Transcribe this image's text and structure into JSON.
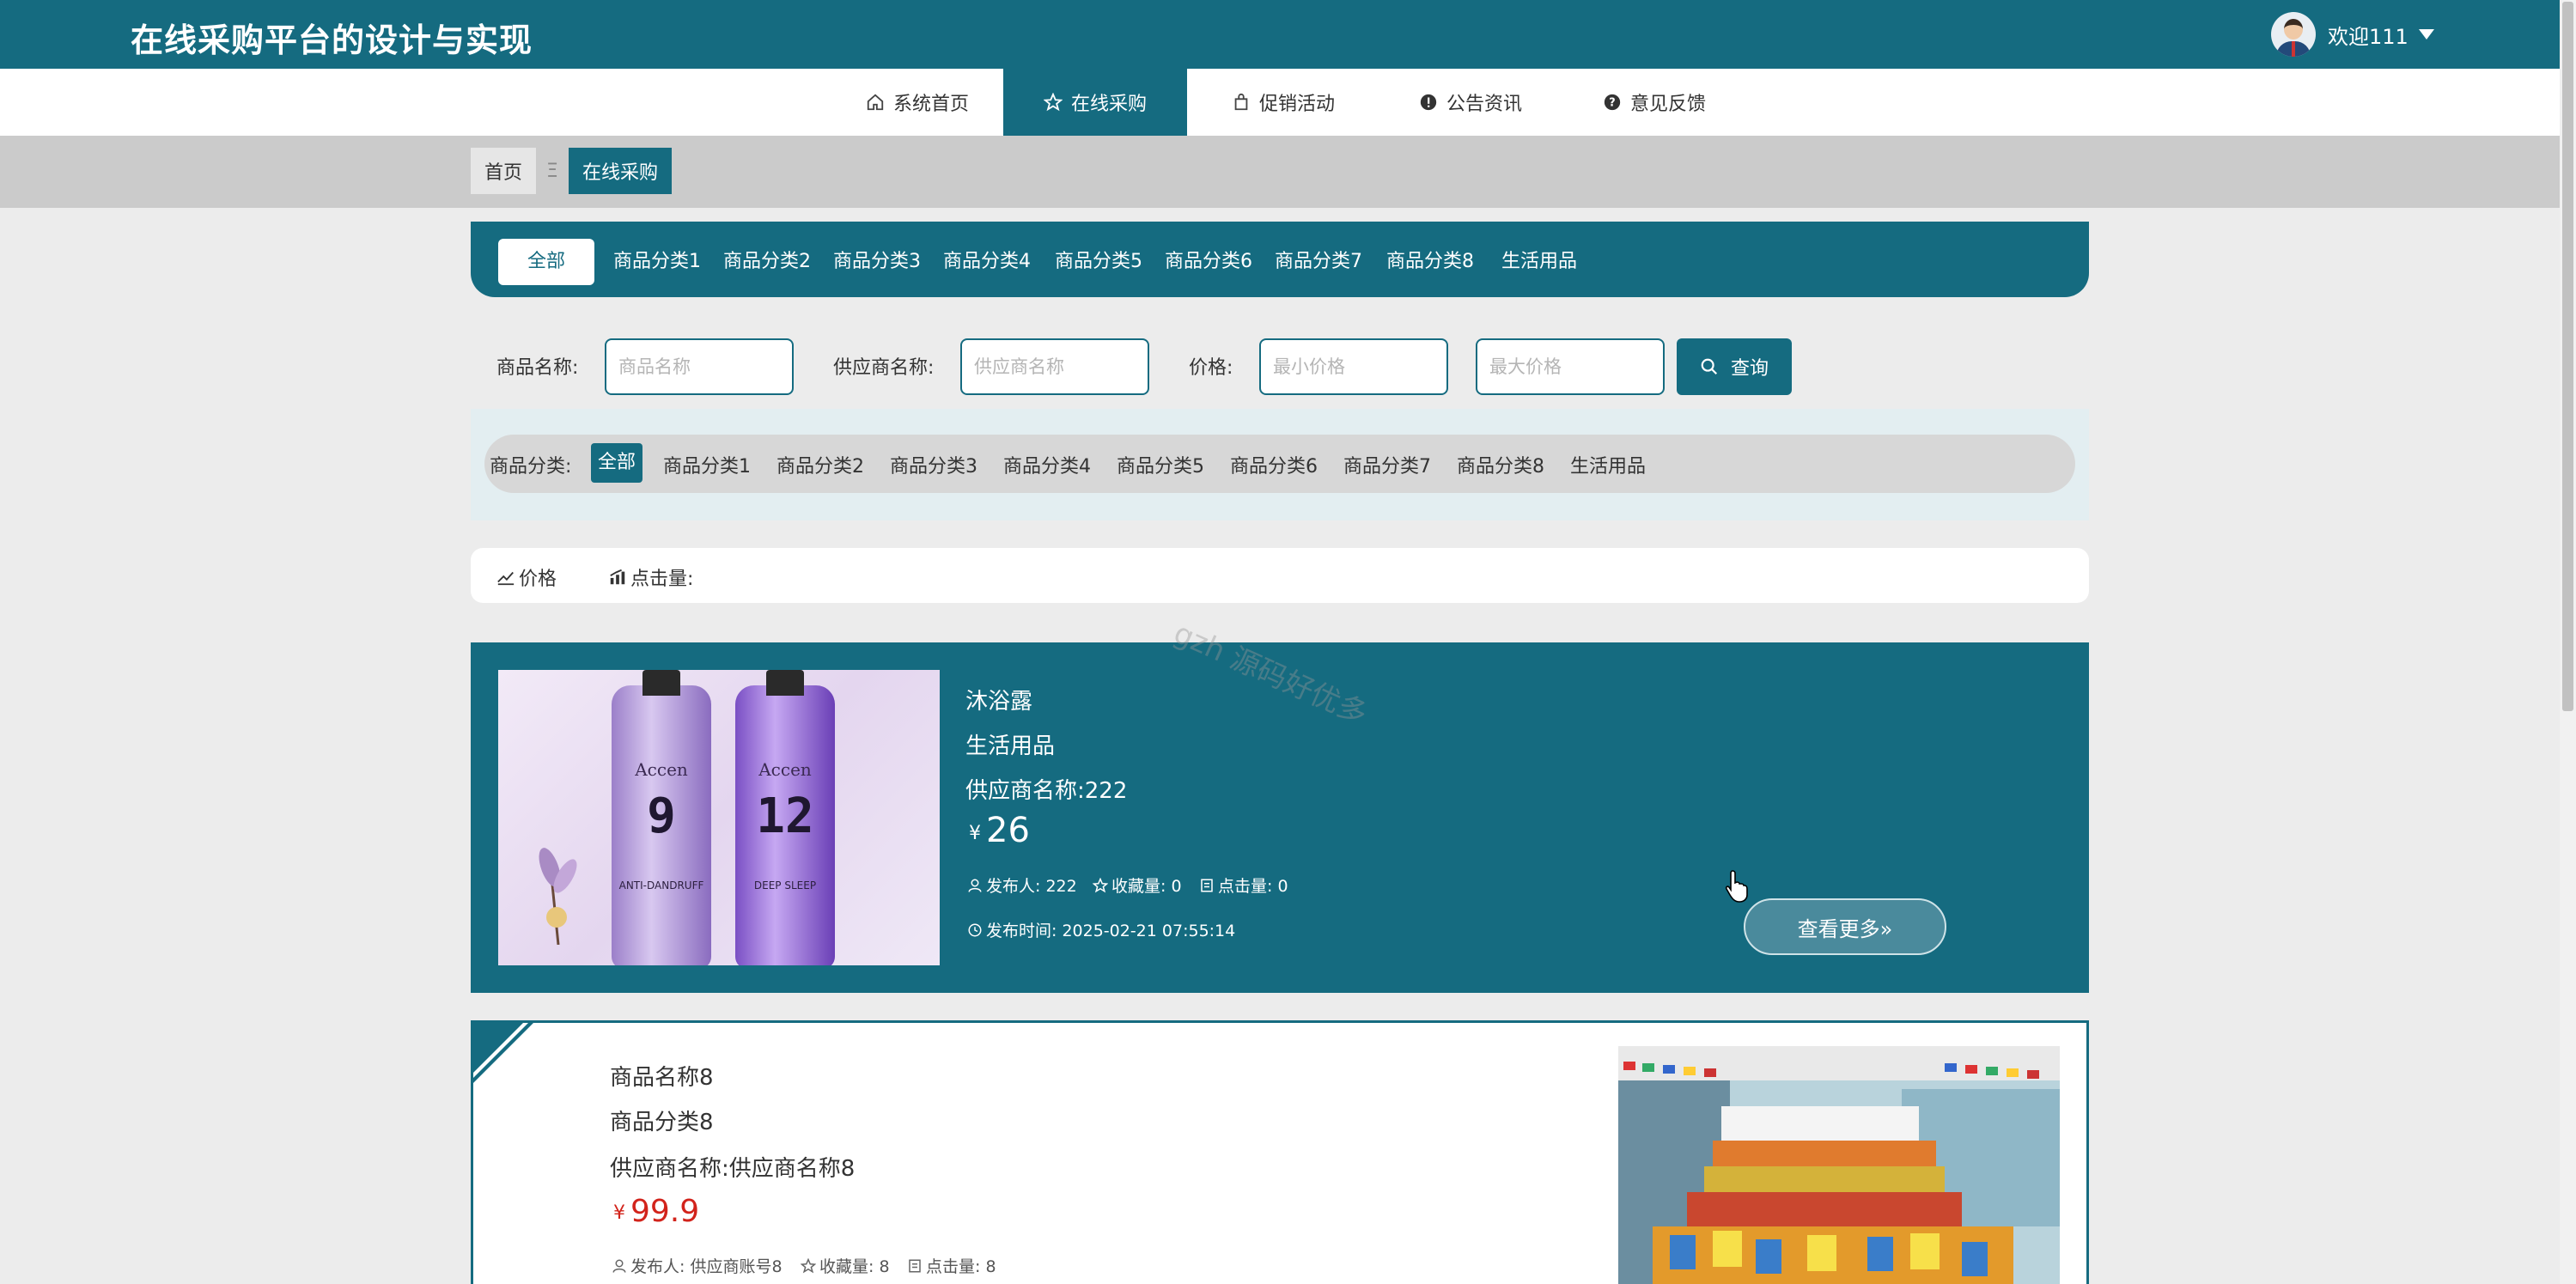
{
  "header": {
    "site_title": "在线采购平台的设计与实现",
    "welcome": "欢迎111"
  },
  "nav": {
    "items": [
      {
        "label": "系统首页",
        "icon": "home-icon"
      },
      {
        "label": "在线采购",
        "icon": "star-icon",
        "active": true
      },
      {
        "label": "促销活动",
        "icon": "bag-icon"
      },
      {
        "label": "公告资讯",
        "icon": "alert-icon"
      },
      {
        "label": "意见反馈",
        "icon": "question-icon"
      }
    ]
  },
  "breadcrumb": {
    "home": "首页",
    "separator": "Ξ",
    "current": "在线采购"
  },
  "category_tabs": [
    "全部",
    "商品分类1",
    "商品分类2",
    "商品分类3",
    "商品分类4",
    "商品分类5",
    "商品分类6",
    "商品分类7",
    "商品分类8",
    "生活用品"
  ],
  "search": {
    "name_label": "商品名称:",
    "name_placeholder": "商品名称",
    "supplier_label": "供应商名称:",
    "supplier_placeholder": "供应商名称",
    "price_label": "价格:",
    "min_placeholder": "最小价格",
    "max_placeholder": "最大价格",
    "button": "查询"
  },
  "filter": {
    "label": "商品分类:",
    "options": [
      "全部",
      "商品分类1",
      "商品分类2",
      "商品分类3",
      "商品分类4",
      "商品分类5",
      "商品分类6",
      "商品分类7",
      "商品分类8",
      "生活用品"
    ]
  },
  "sort": {
    "price": "价格",
    "clicks": "点击量:"
  },
  "watermark": "gzh 源码好优多",
  "products": [
    {
      "name": "沐浴露",
      "category": "生活用品",
      "supplier": "供应商名称:222",
      "currency": "¥",
      "price": "26",
      "publisher": "发布人: 222",
      "favorites": "收藏量: 0",
      "clicks": "点击量: 0",
      "publish_time": "发布时间: 2025-02-21 07:55:14",
      "more": "查看更多»",
      "image_text": {
        "brand": "Accen",
        "num_left": "9",
        "num_right": "12",
        "sub_left": "ANTI-DANDRUFF",
        "sub_right": "DEEP SLEEP"
      }
    },
    {
      "name": "商品名称8",
      "category": "商品分类8",
      "supplier": "供应商名称:供应商名称8",
      "currency": "¥",
      "price": "99.9",
      "publisher": "发布人: 供应商账号8",
      "favorites": "收藏量: 8",
      "clicks": "点击量: 8"
    }
  ],
  "colors": {
    "primary": "#156b80",
    "price_red": "#d2231b"
  }
}
